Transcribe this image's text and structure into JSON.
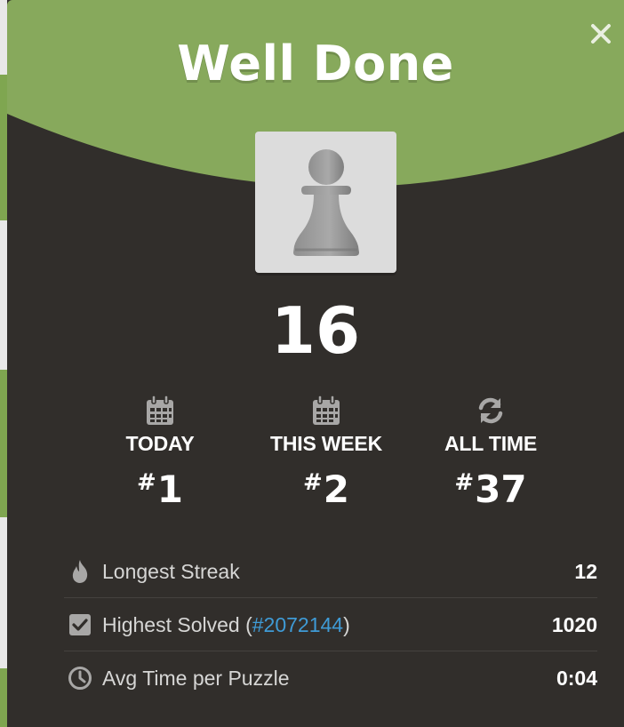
{
  "modal": {
    "title": "Well Done",
    "close_icon": "close-icon",
    "piece_icon": "pawn-icon",
    "rating": "16"
  },
  "ranks": [
    {
      "icon": "calendar-icon",
      "label": "TODAY",
      "hash": "#",
      "value": "1"
    },
    {
      "icon": "calendar-icon",
      "label": "THIS WEEK",
      "hash": "#",
      "value": "2"
    },
    {
      "icon": "refresh-icon",
      "label": "ALL TIME",
      "hash": "#",
      "value": "37"
    }
  ],
  "stats": [
    {
      "icon": "flame-icon",
      "label": "Longest Streak",
      "value": "12"
    },
    {
      "icon": "checkbox-icon",
      "label_prefix": "Highest Solved (",
      "link": "#2072144",
      "label_suffix": ")",
      "value": "1020"
    },
    {
      "icon": "clock-icon",
      "label": "Avg Time per Puzzle",
      "value": "0:04"
    }
  ],
  "colors": {
    "header_green": "#87a95c",
    "panel_bg": "#312e2b",
    "link_blue": "#3f9bd6",
    "icon_gray": "#a8a7a6"
  }
}
